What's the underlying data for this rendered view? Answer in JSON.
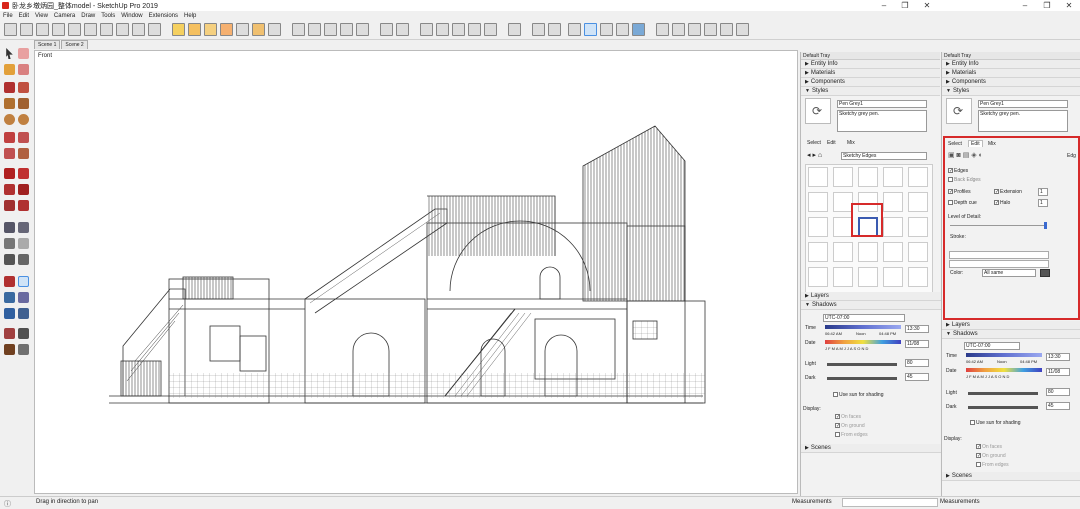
{
  "window": {
    "title": "卧龙乡墩炳园_整体model - SketchUp Pro 2019",
    "min": "–",
    "restore": "❐",
    "close": "✕"
  },
  "menus": [
    "File",
    "Edit",
    "View",
    "Camera",
    "Draw",
    "Tools",
    "Window",
    "Extensions",
    "Help"
  ],
  "scenes": [
    "Scene 1",
    "Scene 2"
  ],
  "viewport": {
    "label": "Front"
  },
  "status": {
    "hint": "Drag in direction to pan",
    "measurements_label": "Measurements"
  },
  "tray": {
    "title": "Default Tray",
    "sections_top": [
      "Entity Info",
      "Materials",
      "Components",
      "Styles"
    ],
    "style": {
      "name": "Pen Grey1",
      "description": "Sketchy grey pen."
    },
    "tabs": [
      "Select",
      "Edit",
      "Mix"
    ],
    "collection": "Sketchy Edges",
    "sections_bottom": [
      "Layers",
      "Shadows"
    ],
    "shadows": {
      "utc": "UTC-07:00",
      "time_label": "Time",
      "time_start": "06:42 AM",
      "time_noon": "Noon",
      "time_end": "04:48 PM",
      "time_value": "13:30",
      "date_label": "Date",
      "months": "J F M A M J J A S O N D",
      "date_value": "11/08",
      "light_label": "Light",
      "light_value": "80",
      "dark_label": "Dark",
      "dark_value": "45",
      "use_sun": "Use sun for shading",
      "display_label": "Display:",
      "on_faces": "On faces",
      "on_ground": "On ground",
      "from_edges": "From edges"
    },
    "scenes_section": "Scenes"
  },
  "edit_panel": {
    "edges_label": "Edges",
    "back_edges": "Back Edges",
    "profiles": "Profiles",
    "extension": "Extension",
    "depth_cue": "Depth cue",
    "halo": "Halo",
    "extension_value": "1",
    "halo_value": "1",
    "level_of_detail": "Level of Detail:",
    "stroke_label": "Stroke:",
    "color_label": "Color:",
    "color_value": "All same",
    "color_swatch": "#555555",
    "edge_label": "Edg"
  }
}
